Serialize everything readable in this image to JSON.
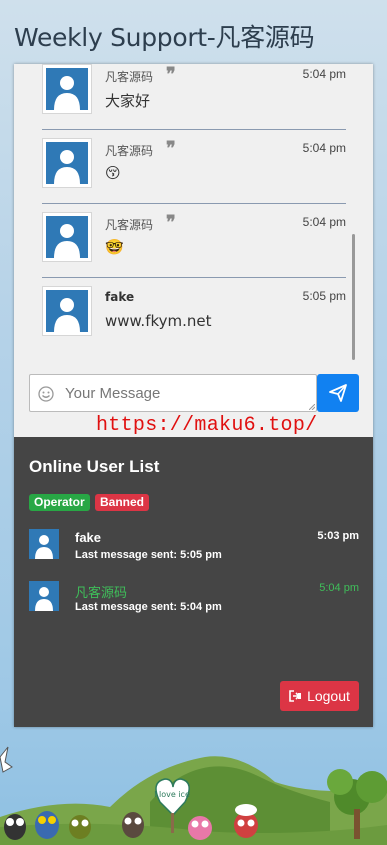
{
  "app": {
    "title": "Weekly Support-凡客源码"
  },
  "messages": [
    {
      "name": "凡客源码",
      "time": "5:04 pm",
      "text": "大家好"
    },
    {
      "name": "凡客源码",
      "time": "5:04 pm",
      "text": "😚"
    },
    {
      "name": "凡客源码",
      "time": "5:04 pm",
      "text": "🤓"
    },
    {
      "name": "fake",
      "time": "5:05 pm",
      "text": "www.fkym.net"
    }
  ],
  "composer": {
    "placeholder": "Your Message"
  },
  "watermark": "https://maku6.top/",
  "online": {
    "title": "Online User List",
    "badges": {
      "operator": "Operator",
      "banned": "Banned"
    },
    "users": [
      {
        "name": "fake",
        "time": "5:03 pm",
        "last": "Last message sent: 5:05 pm"
      },
      {
        "name": "凡客源码",
        "time": "5:04 pm",
        "last": "Last message sent: 5:04 pm"
      }
    ],
    "logout_label": "Logout"
  },
  "scene": {
    "sign_text": "I love ice"
  },
  "colors": {
    "send": "#1181f1",
    "operator": "#28a745",
    "banned": "#dc3545",
    "operator_name": "#3fbf5a",
    "watermark": "#e01010"
  }
}
